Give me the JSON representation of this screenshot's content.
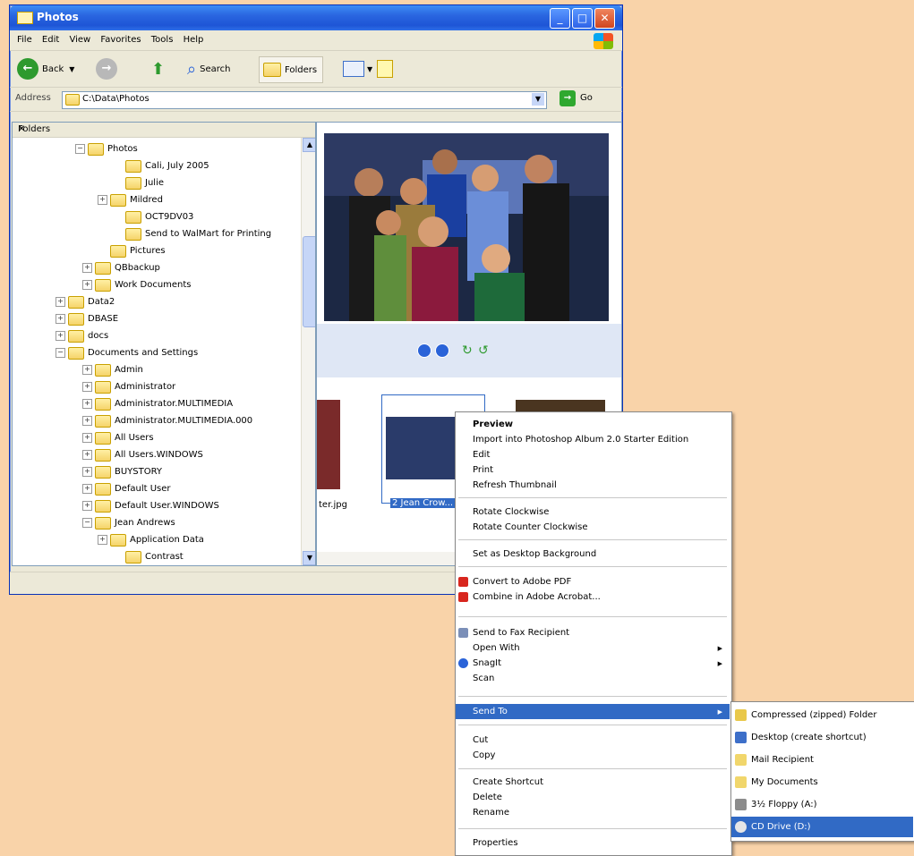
{
  "window": {
    "title": "Photos"
  },
  "menubar": [
    "File",
    "Edit",
    "View",
    "Favorites",
    "Tools",
    "Help"
  ],
  "toolbar": {
    "back": "Back",
    "search": "Search",
    "folders": "Folders"
  },
  "address": {
    "label": "Address",
    "value": "C:\\Data\\Photos",
    "go": "Go"
  },
  "folders_pane": {
    "title": "Folders",
    "items": [
      {
        "label": "Photos",
        "exp": "−"
      },
      {
        "label": "Cali, July 2005",
        "exp": ""
      },
      {
        "label": "Julie",
        "exp": ""
      },
      {
        "label": "Mildred",
        "exp": "+"
      },
      {
        "label": "OCT9DV03",
        "exp": ""
      },
      {
        "label": "Send to WalMart for Printing",
        "exp": ""
      },
      {
        "label": "Pictures",
        "exp": ""
      },
      {
        "label": "QBbackup",
        "exp": "+"
      },
      {
        "label": "Work Documents",
        "exp": "+"
      },
      {
        "label": "Data2",
        "exp": "+"
      },
      {
        "label": "DBASE",
        "exp": "+"
      },
      {
        "label": "docs",
        "exp": "+"
      },
      {
        "label": "Documents and Settings",
        "exp": "−"
      },
      {
        "label": "Admin",
        "exp": "+"
      },
      {
        "label": "Administrator",
        "exp": "+"
      },
      {
        "label": "Administrator.MULTIMEDIA",
        "exp": "+"
      },
      {
        "label": "Administrator.MULTIMEDIA.000",
        "exp": "+"
      },
      {
        "label": "All Users",
        "exp": "+"
      },
      {
        "label": "All Users.WINDOWS",
        "exp": "+"
      },
      {
        "label": "BUYSTORY",
        "exp": "+"
      },
      {
        "label": "Default User",
        "exp": "+"
      },
      {
        "label": "Default User.WINDOWS",
        "exp": "+"
      },
      {
        "label": "Jean Andrews",
        "exp": "−"
      },
      {
        "label": "Application Data",
        "exp": "+"
      },
      {
        "label": "Contrast",
        "exp": ""
      }
    ]
  },
  "thumbnails": {
    "left_caption": "ter.jpg",
    "selected_caption": "2 Jean Crow..."
  },
  "context_menu": {
    "items": [
      "Preview",
      "Import into Photoshop Album 2.0 Starter Edition",
      "Edit",
      "Print",
      "Refresh Thumbnail",
      "Rotate Clockwise",
      "Rotate Counter Clockwise",
      "Set as Desktop Background",
      "Convert to Adobe PDF",
      "Combine in Adobe Acrobat...",
      "Send to Fax Recipient",
      "Open With",
      "SnagIt",
      "Scan",
      "Send To",
      "Cut",
      "Copy",
      "Create Shortcut",
      "Delete",
      "Rename",
      "Properties"
    ]
  },
  "send_to_menu": {
    "items": [
      "Compressed (zipped) Folder",
      "Desktop (create shortcut)",
      "Mail Recipient",
      "My Documents",
      "3½ Floppy (A:)",
      "CD Drive (D:)"
    ]
  },
  "colors": {
    "background": "#f9d3a9",
    "selection": "#316ac5",
    "titlebar": "#2a66e0"
  }
}
